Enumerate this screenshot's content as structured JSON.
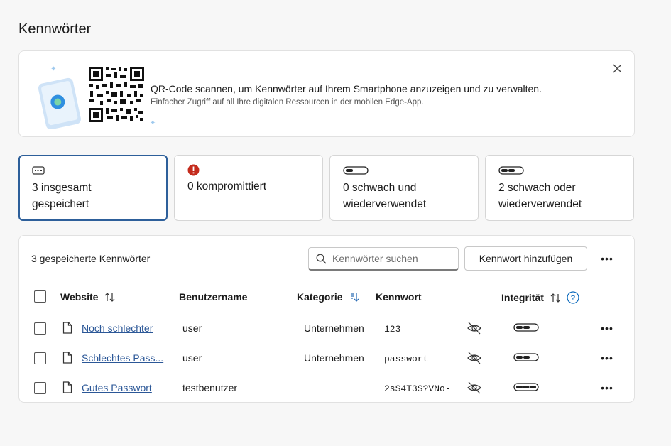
{
  "page": {
    "title": "Kennwörter"
  },
  "qr_banner": {
    "main_text": "QR-Code scannen, um Kennwörter auf Ihrem Smartphone anzuzeigen und zu verwalten.",
    "sub_text": "Einfacher Zugriff auf all Ihre digitalen Ressourcen in der mobilen Edge-App.",
    "close_icon": "close-icon"
  },
  "cards": [
    {
      "label_line1": "3 insgesamt",
      "label_line2": "gespeichert",
      "icon": "password-card-icon",
      "selected": true
    },
    {
      "label_line1": "0 kompromittiert",
      "label_line2": "",
      "icon": "warning-icon",
      "selected": false
    },
    {
      "label_line1": "0 schwach und",
      "label_line2": "wiederverwendet",
      "icon": "weak-strength-icon",
      "selected": false
    },
    {
      "label_line1": "2 schwach oder",
      "label_line2": "wiederverwendet",
      "icon": "medium-strength-icon",
      "selected": false
    }
  ],
  "list": {
    "count_label": "3 gespeicherte Kennwörter",
    "search_placeholder": "Kennwörter suchen",
    "add_button_label": "Kennwort hinzufügen",
    "columns": {
      "website": "Website",
      "username": "Benutzername",
      "category": "Kategorie",
      "password": "Kennwort",
      "health": "Integrität"
    },
    "rows": [
      {
        "site": "Noch schlechter",
        "username": "user",
        "category": "Unternehmen",
        "password": "123",
        "strength": "weak"
      },
      {
        "site": "Schlechtes Pass...",
        "username": "user",
        "category": "Unternehmen",
        "password": "passwort",
        "strength": "weak"
      },
      {
        "site": "Gutes Passwort",
        "username": "testbenutzer",
        "category": "",
        "password": "2sS4T3S?VNo-",
        "strength": "strong"
      }
    ]
  },
  "colors": {
    "accent": "#2d5f9a",
    "link": "#2b5797",
    "warning": "#c42b1c",
    "help": "#0f6cbd"
  }
}
